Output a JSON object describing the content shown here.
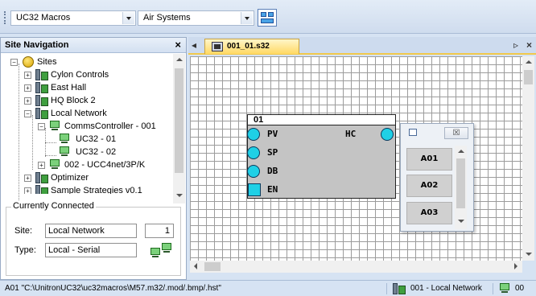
{
  "toolbar": {
    "macro_combo": "UC32 Macros",
    "system_combo": "Air Systems",
    "layout_icon": "layout-grid-icon"
  },
  "site_nav": {
    "title": "Site Navigation",
    "close": "×",
    "tree": [
      {
        "label": "Sites",
        "expander": "−",
        "icon": "globe"
      },
      {
        "label": "Cylon Controls",
        "expander": "+",
        "icon": "server"
      },
      {
        "label": "East Hall",
        "expander": "+",
        "icon": "server"
      },
      {
        "label": "HQ Block 2",
        "expander": "+",
        "icon": "server"
      },
      {
        "label": "Local Network",
        "expander": "−",
        "icon": "server"
      },
      {
        "label": "CommsController - 001",
        "expander": "−",
        "icon": "computer"
      },
      {
        "label": "UC32 - 01",
        "expander": "",
        "icon": "computer-arrow"
      },
      {
        "label": "UC32 - 02",
        "expander": "",
        "icon": "computer"
      },
      {
        "label": "002 - UCC4net/3P/K",
        "expander": "+",
        "icon": "computer"
      },
      {
        "label": "Optimizer",
        "expander": "+",
        "icon": "server"
      },
      {
        "label": "Sample Strategies v0.1",
        "expander": "+",
        "icon": "server"
      }
    ]
  },
  "connected": {
    "legend": "Currently Connected",
    "site_label": "Site:",
    "site_value": "Local Network",
    "site_number": "1",
    "type_label": "Type:",
    "type_value": "Local - Serial"
  },
  "tabs": {
    "left_arrow": "◂",
    "doc_tab": "001_01.s32",
    "right_arrow": "▹",
    "close": "×"
  },
  "block": {
    "title": "01",
    "inputs": [
      "PV",
      "SP",
      "DB",
      "EN"
    ],
    "output": "HC"
  },
  "popup": {
    "close": "☒",
    "items": [
      "A01",
      "A02",
      "A03"
    ]
  },
  "status": {
    "path": "A01 \"C:\\UnitronUC32\\uc32macros\\M57.m32/.mod/.bmp/.hst\"",
    "network": "001 - Local Network",
    "extra": "00"
  },
  "colors": {
    "port": "#1fd0e6",
    "block_body": "#c4c4c4",
    "tab_accent": "#ffd964",
    "chrome": "#d6e3f3"
  }
}
